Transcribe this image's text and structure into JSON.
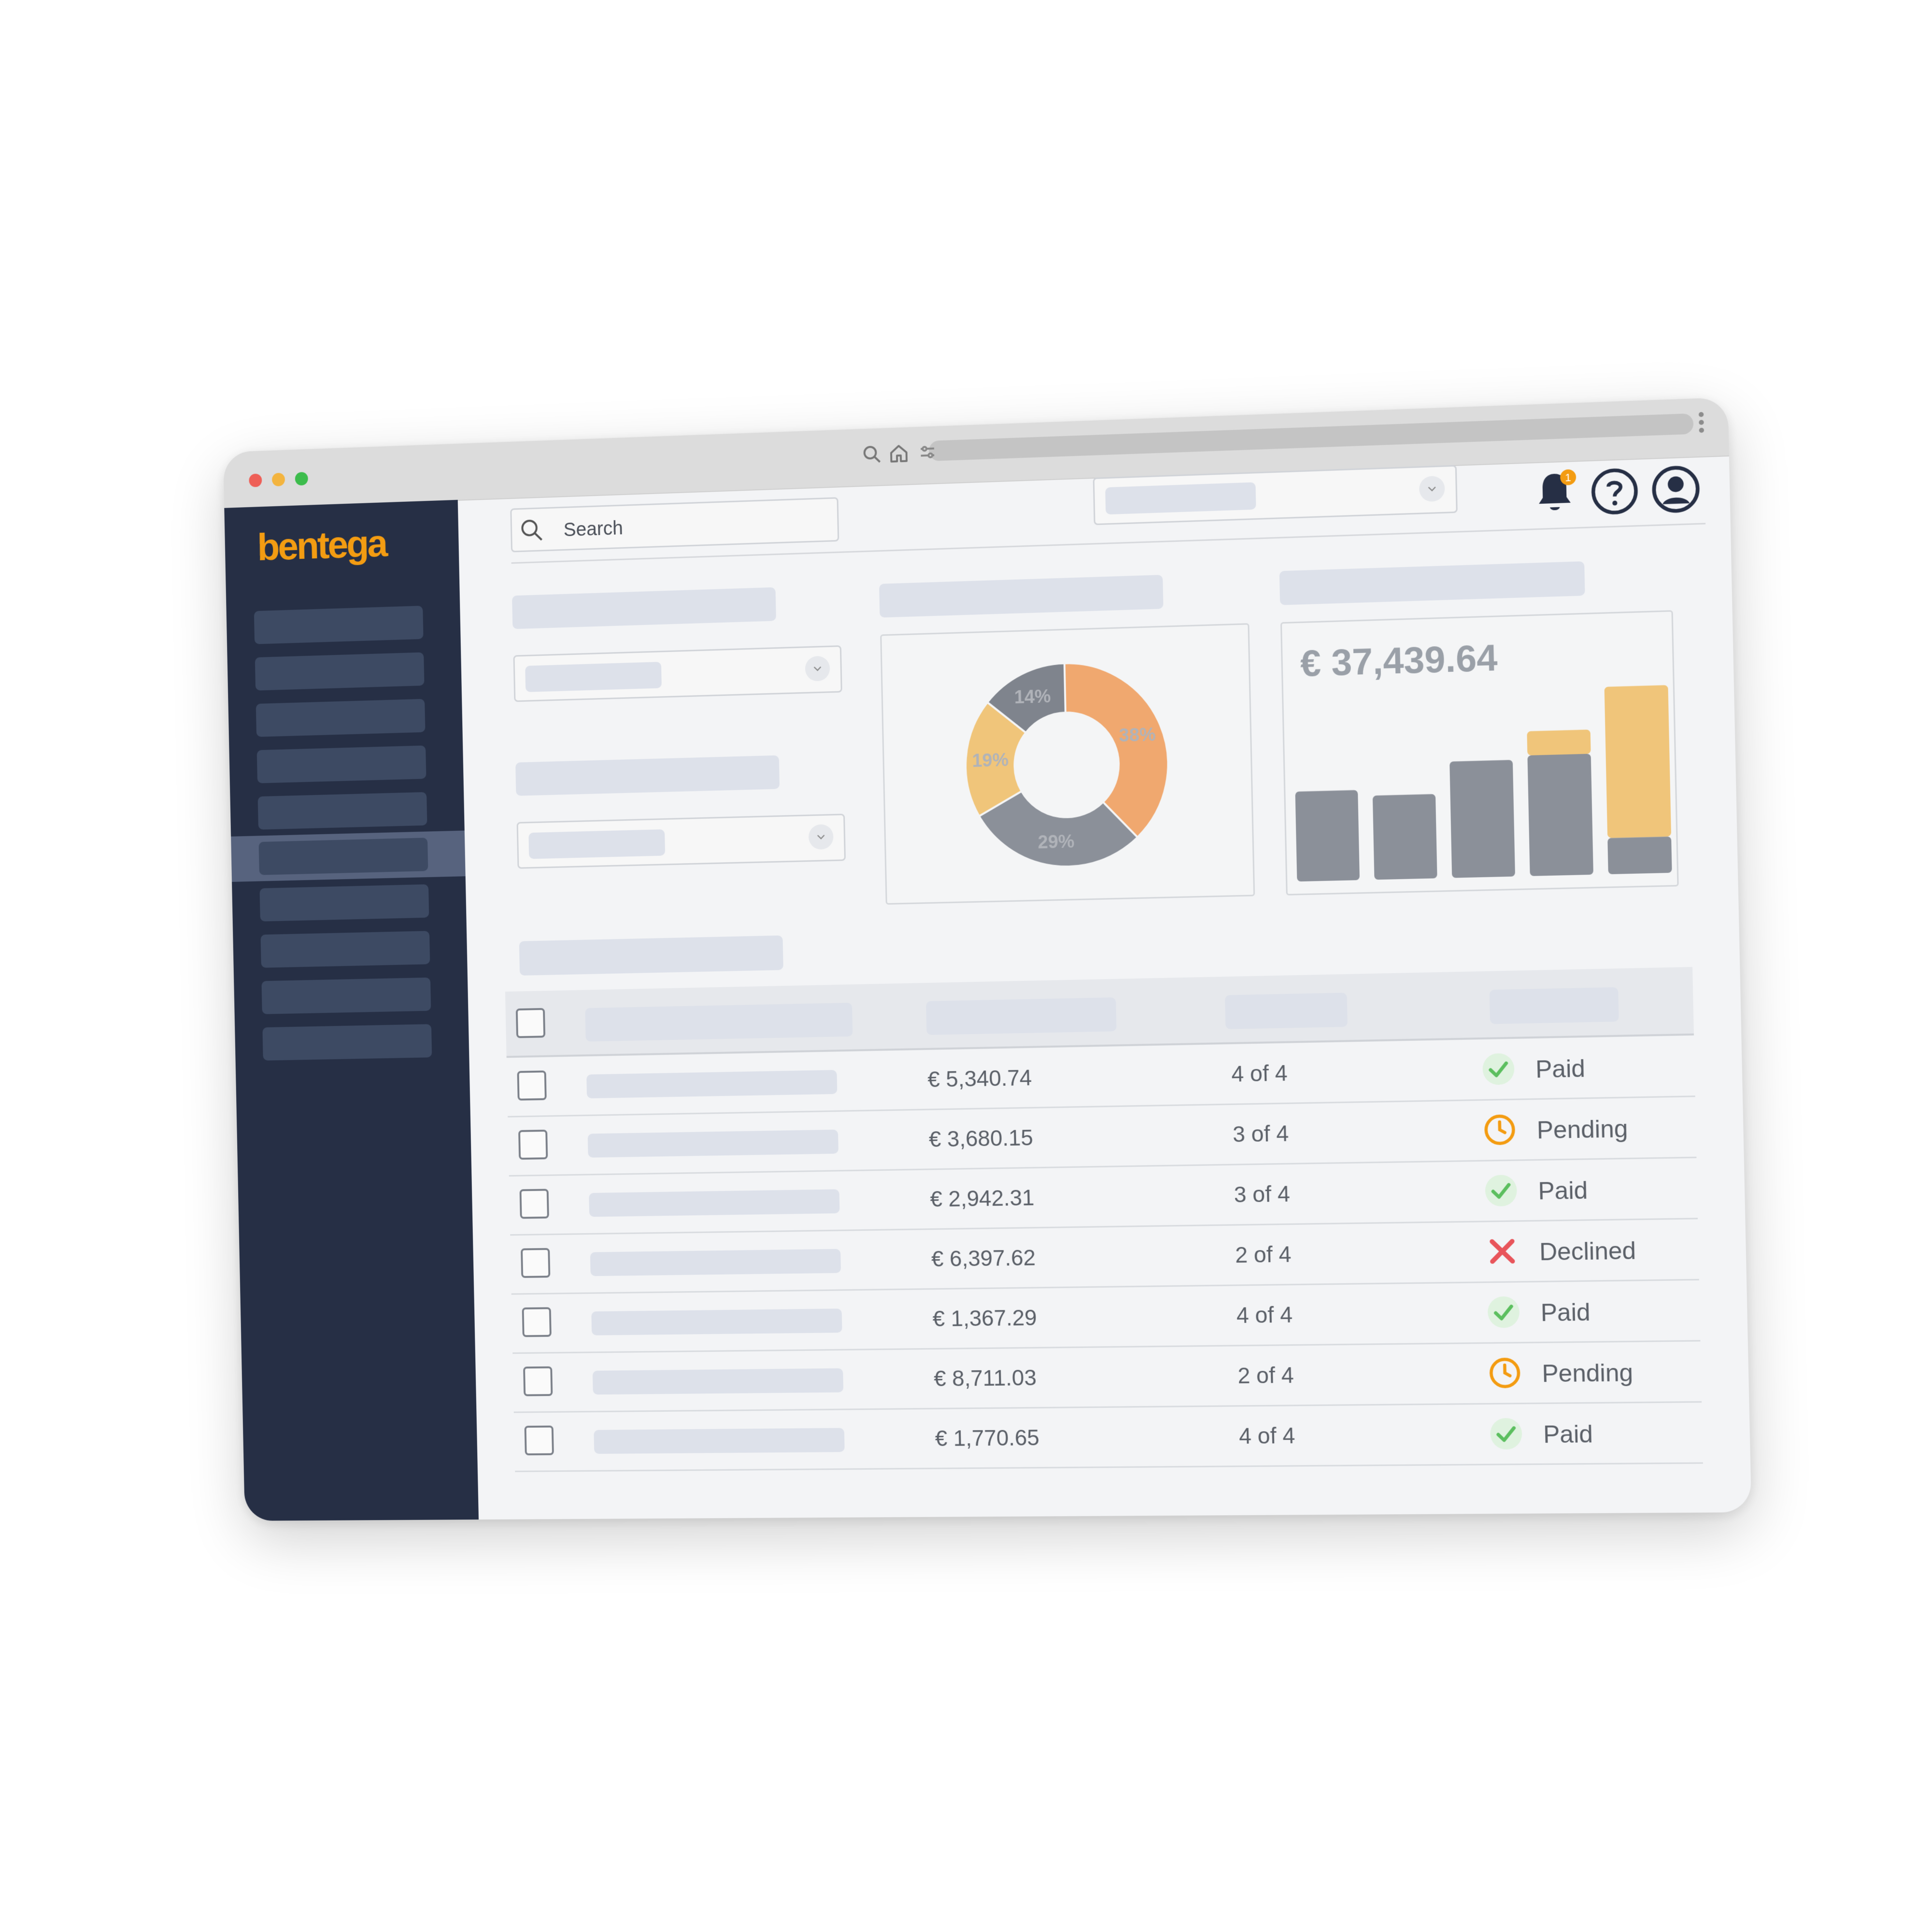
{
  "brand": {
    "logo": "bentega",
    "accent": "#f39c12"
  },
  "search": {
    "placeholder": "Search"
  },
  "notifications": {
    "count": "1"
  },
  "icons": [
    "search-icon",
    "home-icon",
    "tune-icon",
    "bell-icon",
    "help-icon",
    "user-icon",
    "chevron-down-icon",
    "check-icon",
    "clock-icon",
    "x-icon"
  ],
  "donut": {
    "slices": [
      {
        "label": "38%",
        "value": 38,
        "color": "#f0a86f"
      },
      {
        "label": "29%",
        "value": 29,
        "color": "#8b9099"
      },
      {
        "label": "19%",
        "value": 19,
        "color": "#f0c57a"
      },
      {
        "label": "14%",
        "value": 14,
        "color": "#7f848d"
      }
    ]
  },
  "chart_data": {
    "type": "bar",
    "title": "€ 37,439.64",
    "series": [
      {
        "values": [
          0.45,
          0.42,
          0.58,
          0.6,
          0.18
        ]
      },
      {
        "values": [
          0,
          0,
          0,
          0.12,
          0.75
        ]
      }
    ],
    "colors": [
      "#8b9099",
      "#f0c57a"
    ],
    "ylim": [
      0,
      1
    ]
  },
  "table": {
    "rows": [
      {
        "amount": "€ 5,340.74",
        "progress": "4 of 4",
        "status": "Paid",
        "kind": "paid"
      },
      {
        "amount": "€ 3,680.15",
        "progress": "3 of 4",
        "status": "Pending",
        "kind": "pending"
      },
      {
        "amount": "€ 2,942.31",
        "progress": "3 of 4",
        "status": "Paid",
        "kind": "paid"
      },
      {
        "amount": "€ 6,397.62",
        "progress": "2 of 4",
        "status": "Declined",
        "kind": "declined"
      },
      {
        "amount": "€ 1,367.29",
        "progress": "4 of 4",
        "status": "Paid",
        "kind": "paid"
      },
      {
        "amount": "€ 8,711.03",
        "progress": "2 of 4",
        "status": "Pending",
        "kind": "pending"
      },
      {
        "amount": "€ 1,770.65",
        "progress": "4 of 4",
        "status": "Paid",
        "kind": "paid"
      }
    ]
  }
}
